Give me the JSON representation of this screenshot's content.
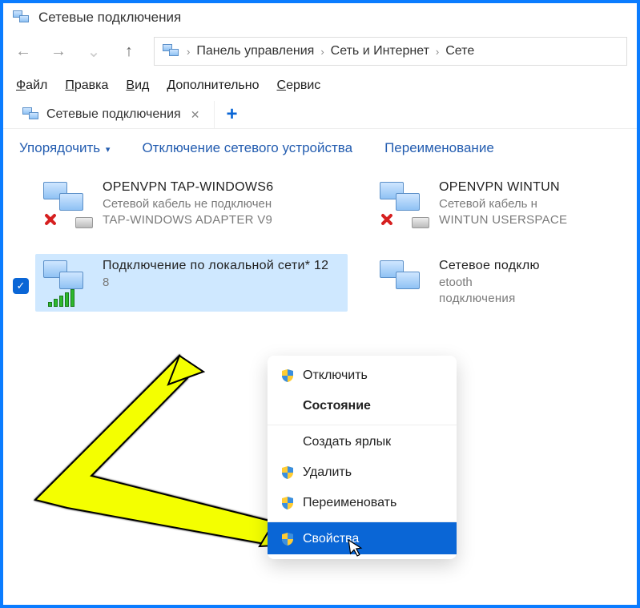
{
  "window": {
    "title": "Сетевые подключения"
  },
  "nav": {
    "breadcrumb": [
      "Панель управления",
      "Сеть и Интернет",
      "Сете"
    ]
  },
  "menubar": [
    "Файл",
    "Правка",
    "Вид",
    "Дополнительно",
    "Сервис"
  ],
  "tab": {
    "label": "Сетевые подключения"
  },
  "toolbar": {
    "organize": "Упорядочить",
    "disable": "Отключение сетевого устройства",
    "rename": "Переименование"
  },
  "connections": [
    {
      "name": "OPENVPN TAP-WINDOWS6",
      "status": "Сетевой кабель не подключен",
      "adapter": "TAP-WINDOWS ADAPTER V9",
      "icon": "disconnected",
      "selected": false
    },
    {
      "name": "OPENVPN WINTUN",
      "status": "Сетевой кабель н",
      "adapter": "WINTUN USERSPACE",
      "icon": "disconnected",
      "selected": false
    },
    {
      "name": "Подключение по локальной сети* 12",
      "status": "",
      "adapter": "8",
      "icon": "wifi",
      "selected": true
    },
    {
      "name": "Сетевое подклю",
      "status": "etooth",
      "adapter": "подключения",
      "icon": "net",
      "selected": false
    }
  ],
  "context_menu": {
    "items": [
      {
        "label": "Отключить",
        "shield": true,
        "bold": false,
        "highlight": false
      },
      {
        "label": "Состояние",
        "shield": false,
        "bold": true,
        "highlight": false
      },
      {
        "label": "Создать ярлык",
        "shield": false,
        "bold": false,
        "highlight": false,
        "gap": true
      },
      {
        "label": "Удалить",
        "shield": true,
        "bold": false,
        "highlight": false
      },
      {
        "label": "Переименовать",
        "shield": true,
        "bold": false,
        "highlight": false
      },
      {
        "label": "Свойства",
        "shield": true,
        "bold": false,
        "highlight": true,
        "gap": true
      }
    ]
  }
}
